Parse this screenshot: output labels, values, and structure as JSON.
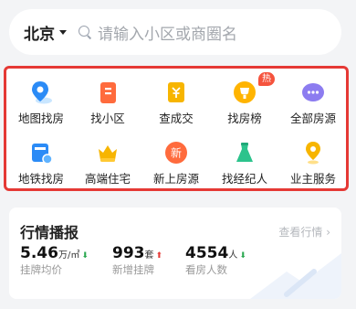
{
  "search": {
    "city": "北京",
    "placeholder": "请输入小区或商圈名"
  },
  "entries": [
    {
      "label": "地图找房",
      "icon": "map-pin-icon"
    },
    {
      "label": "找小区",
      "icon": "building-icon"
    },
    {
      "label": "查成交",
      "icon": "deal-money-icon"
    },
    {
      "label": "找房榜",
      "icon": "ranking-trophy-icon",
      "badge": "热"
    },
    {
      "label": "全部房源",
      "icon": "all-listings-icon"
    },
    {
      "label": "地铁找房",
      "icon": "subway-icon"
    },
    {
      "label": "高端住宅",
      "icon": "luxury-crown-icon"
    },
    {
      "label": "新上房源",
      "icon": "new-listing-icon",
      "icon_text": "新"
    },
    {
      "label": "找经纪人",
      "icon": "agent-icon"
    },
    {
      "label": "业主服务",
      "icon": "owner-service-icon"
    }
  ],
  "market": {
    "title": "行情播报",
    "link": "查看行情",
    "stats": [
      {
        "value": "5.46",
        "unit": "万/㎡",
        "trend": "down",
        "label": "挂牌均价"
      },
      {
        "value": "993",
        "unit": "套",
        "trend": "up",
        "label": "新增挂牌"
      },
      {
        "value": "4554",
        "unit": "人",
        "trend": "down",
        "label": "看房人数"
      }
    ]
  },
  "colors": {
    "accent_red": "#e53935",
    "up": "#e53935",
    "down": "#2aa850"
  }
}
